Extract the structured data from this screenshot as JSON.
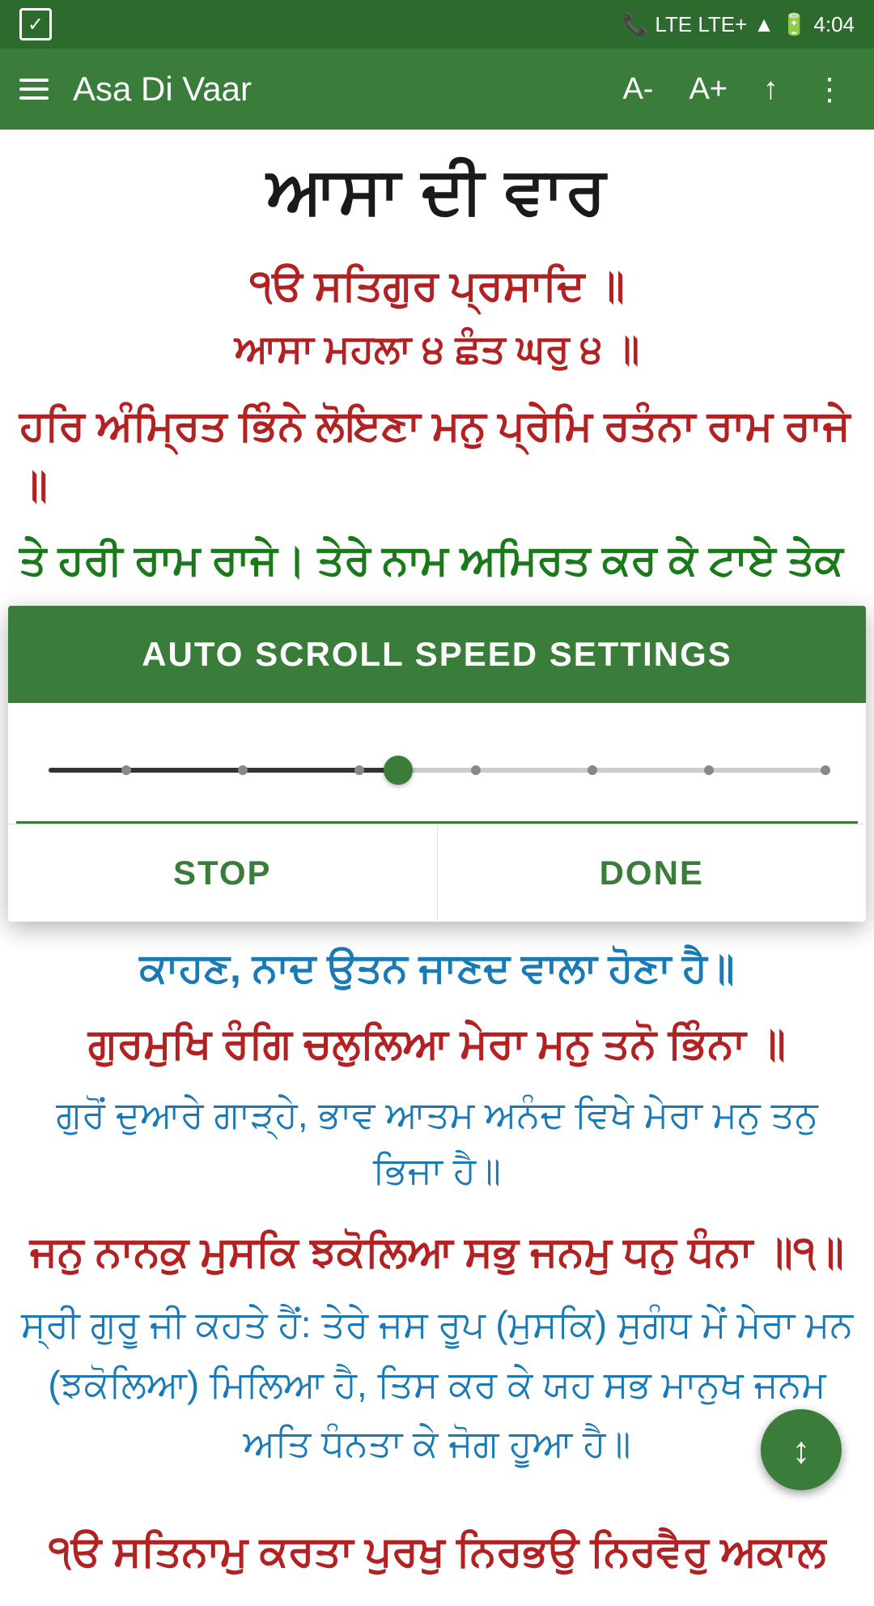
{
  "statusBar": {
    "network": "LTE  LTE+",
    "time": "4:04"
  },
  "appBar": {
    "title": "Asa Di Vaar",
    "fontDecreaseLabel": "A-",
    "fontIncreaseLabel": "A+",
    "scrollUpLabel": "↑",
    "moreLabel": "⋮"
  },
  "content": {
    "pageTitle": "ਆਸਾ ਦੀ ਵਾਰ",
    "verseIk": "੧ੳ ਸਤਿਗੁਰ ਪ੍ਰਸਾਦਿ ॥",
    "verseMahala": "ਆਸਾ ਮਹਲਾ ੪ ਛੰਤ ਘਰੁ ੪ ॥",
    "verseLine1": "ਹਰਿ ਅੰਮ੍ਰਿਤ ਭਿੰਨੇ ਲੋਇਣਾ ਮਨੁ ਪ੍ਰੇਮਿ ਰਤੰਨਾ ਰਾਮ ਰਾਜੇ ॥",
    "verseLine2Partial": "ਤੇ ਹਰੀ ਰਾਮ ਰਾਜੇ। ਤੇਰੇ ਨਾਮ ਅਮਿਰਤ ਕਰ ਕੇ ਟਾਏ ਤੇਕ"
  },
  "dialog": {
    "title": "AUTO SCROLL SPEED SETTINGS",
    "sliderValue": 45,
    "sliderMin": 0,
    "sliderMax": 100,
    "stopLabel": "STOP",
    "doneLabel": "DONE",
    "dotPositions": [
      10,
      25,
      40,
      55,
      70,
      85,
      100
    ]
  },
  "contentBelow": {
    "verseBlue1": "ਕਾਹਣ, ਨਾਦ ਉਤਨ ਜਾਣਦ ਵਾਲਾ ਹੋਣਾ ਹੈ॥",
    "verseRed1": "ਗੁਰਮੁਖਿ ਰੰਗਿ ਚਲੁਲਿਆ ਮੇਰਾ ਮਨੁ ਤਨੋ ਭਿੰਨਾ ॥",
    "verseBlueTranslation": "ਗੁਰੋਂ ਦੁਆਰੇ ਗਾੜ੍ਹੇ, ਭਾਵ ਆਤਮ ਅਨੰਦ ਵਿਖੇ ਮੇਰਾ ਮਨੁ ਤਨੁ ਭਿਜਾ ਹੈ॥",
    "verseRedNumbered": "ਜਨੁ ਨਾਨਕੁ ਮੁਸਕਿ ਝਕੋਲਿਆ ਸਭੁ ਜਨਮੁ ਧਨੁ ਧੰਨਾ ॥੧॥",
    "verseBlueLong": "ਸ੍ਰੀ ਗੁਰੂ ਜੀ ਕਹਤੇ ਹੈਂ: ਤੇਰੇ ਜਸ ਰੂਪ (ਮੁਸਕਿ) ਸੁਗੰਧ ਮੇਂ ਮੇਰਾ ਮਨ (ਝਕੋਲਿਆ) ਮਿਲਿਆ ਹੈ, ਤਿਸ ਕਰ ਕੇ ਯਹ ਸਭ ਮਾਨੁਖ ਜਨਮ ਅਤਿ ਧੰਨਤਾ ਕੇ ਜੋਗ ਹੂਆ ਹੈ॥"
  },
  "fab": {
    "icon": "↕"
  },
  "contentBottom": {
    "verseRedBottom": "੧ੳ ਸਤਿਨਾਮੁ ਕਰਤਾ ਪੁਰਖੁ ਨਿਰਭਉ ਨਿਰਵੈਰੁ ਅਕਾਲ"
  }
}
